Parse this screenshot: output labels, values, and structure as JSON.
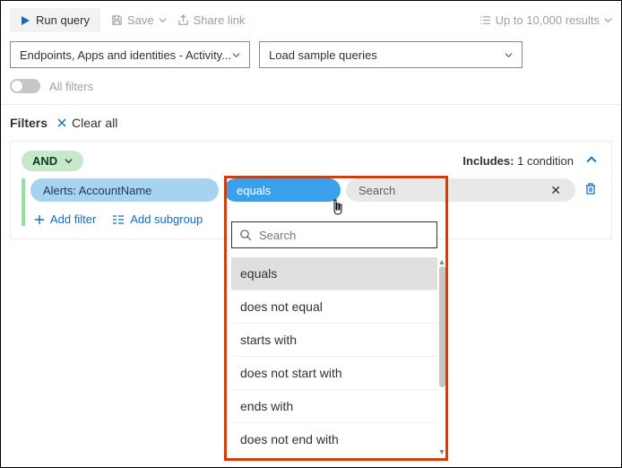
{
  "toolbar": {
    "run": "Run query",
    "save": "Save",
    "share": "Share link",
    "results": "Up to 10,000 results"
  },
  "query": {
    "scope": "Endpoints, Apps and identities - Activity...",
    "sample": "Load sample queries"
  },
  "allfilters_label": "All filters",
  "filters": {
    "title": "Filters",
    "clear": "Clear all"
  },
  "card": {
    "op": "AND",
    "includes_label": "Includes:",
    "includes_count": "1 condition",
    "field": "Alerts: AccountName",
    "operator": "equals",
    "value_placeholder": "Search",
    "add_filter": "Add filter",
    "add_subgroup": "Add subgroup"
  },
  "dropdown": {
    "search_placeholder": "Search",
    "items": [
      "equals",
      "does not equal",
      "starts with",
      "does not start with",
      "ends with",
      "does not end with"
    ],
    "selected": "equals"
  }
}
